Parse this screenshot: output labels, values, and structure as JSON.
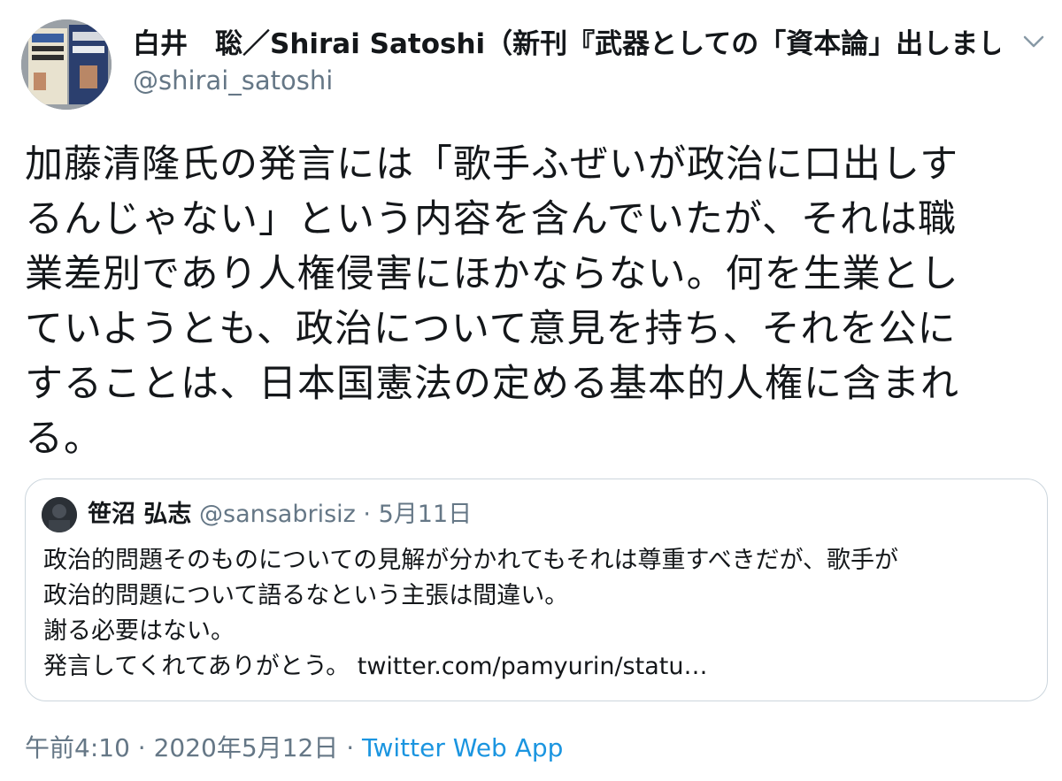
{
  "author": {
    "display_name": "白井　聡／Shirai Satoshi（新刊『武器としての「資本論」出しまし…",
    "handle": "@shirai_satoshi"
  },
  "menu_icon": "chevron-down-icon",
  "tweet_lines": [
    "加藤清隆氏の発言には「歌手ふぜいが政治に口出しす",
    "るんじゃない」という内容を含んでいたが、それは職",
    "業差別であり人権侵害にほかならない。何を生業とし",
    "ていようとも、政治について意見を持ち、それを公に",
    "することは、日本国憲法の定める基本的人権に含まれ",
    "る。"
  ],
  "quoted": {
    "name": "笹沼 弘志",
    "handle": "@sansabrisiz",
    "separator": "·",
    "date": "5月11日",
    "lines": [
      "政治的問題そのものについての見解が分かれてもそれは尊重すべきだが、歌手が",
      "政治的問題について語るなという主張は間違い。",
      "謝る必要はない。",
      "発言してくれてありがとう。"
    ],
    "link": "twitter.com/pamyurin/statu…"
  },
  "meta": {
    "time": "午前4:10",
    "sep1": "·",
    "date": "2020年5月12日",
    "sep2": "·",
    "source": "Twitter Web App"
  },
  "colors": {
    "text": "#14171a",
    "secondary": "#657786",
    "link": "#1b95e0",
    "border": "#ccd6dd"
  }
}
